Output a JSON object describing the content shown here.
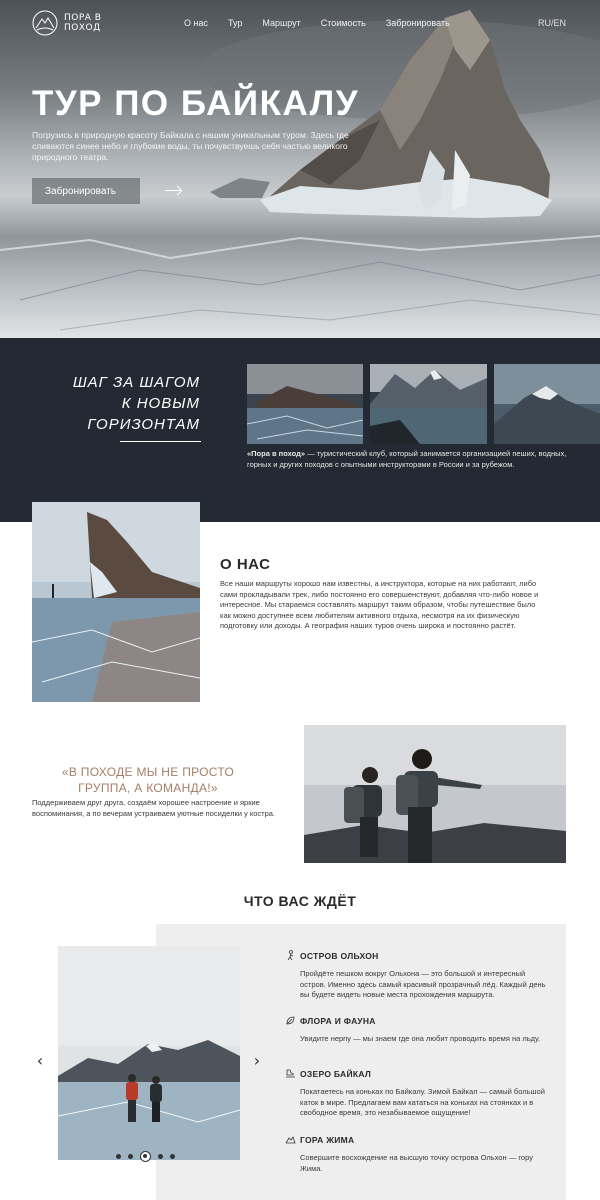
{
  "header": {
    "logo_text": "ПОРА В ПОХОД",
    "nav": [
      "О нас",
      "Тур",
      "Маршрут",
      "Стоимость",
      "Забронировать"
    ],
    "lang": "RU/EN"
  },
  "hero": {
    "title": "ТУР ПО БАЙКАЛУ",
    "subtitle": "Погрузись в природную красоту Байкала с нашим уникальным туром. Здесь где сливаются синее небо и глубокие воды, ты почувствуешь себя частью великого природного театра.",
    "cta": "Забронировать"
  },
  "club": {
    "title_lines": [
      "ШАГ ЗА ШАГОМ",
      "К НОВЫМ",
      "ГОРИЗОНТАМ"
    ],
    "text_bold": "«Пора в поход»",
    "text_rest": " — туристический клуб, который занимается организацией пеших, водных, горных и других походов с опытными инструкторами в России и за рубежом."
  },
  "about": {
    "title": "О НАС",
    "text": "Все наши маршруты хорошо нам известны, а инструктора, которые на них работают, либо сами прокладывали трек, либо постоянно его совершенствуют, добавляя что-либо новое и интересное. Мы стараемся составлять маршрут таким образом, чтобы путешествие было как можно доступнее всем любителям активного отдыха, несмотря на их физическую подготовку или доходы. А география наших туров очень широка и постоянно растёт."
  },
  "quote": {
    "title": "«В ПОХОДЕ МЫ НЕ ПРОСТО ГРУППА, А КОМАНДА!»",
    "text": "Поддерживаем друг друга, создаём хорошее настроение и яркие воспоминания, а по вечерам устраиваем уютные посиделки у костра."
  },
  "expect": {
    "title": "ЧТО ВАС ЖДЁТ",
    "prev": "‹",
    "next": "›",
    "slides": 5,
    "active_slide": 3,
    "features": [
      {
        "icon": "hiker-icon",
        "title": "ОСТРОВ ОЛЬХОН",
        "text": "Пройдёте пешком вокруг Ольхона — это большой и интересный остров. Именно здесь самый красивый прозрачный лёд. Каждый день вы будете видеть новые места прохождения маршрута."
      },
      {
        "icon": "leaf-icon",
        "title": "ФЛОРА И ФАУНА",
        "text": "Увидите нерпу — мы знаем где она любит проводить время на льду."
      },
      {
        "icon": "skate-icon",
        "title": "ОЗЕРО БАЙКАЛ",
        "text": "Покатаетесь на коньках по Байкалу. Зимой Байкал — самый большой каток в мире. Предлагаем вам кататься на коньках на стоянках и в свободное время, это незабываемое ощущение!"
      },
      {
        "icon": "mountain-icon",
        "title": "ГОРА ЖИМА",
        "text": "Совершите восхождение на высшую точку острова Ольхон — гору Жима."
      }
    ]
  }
}
